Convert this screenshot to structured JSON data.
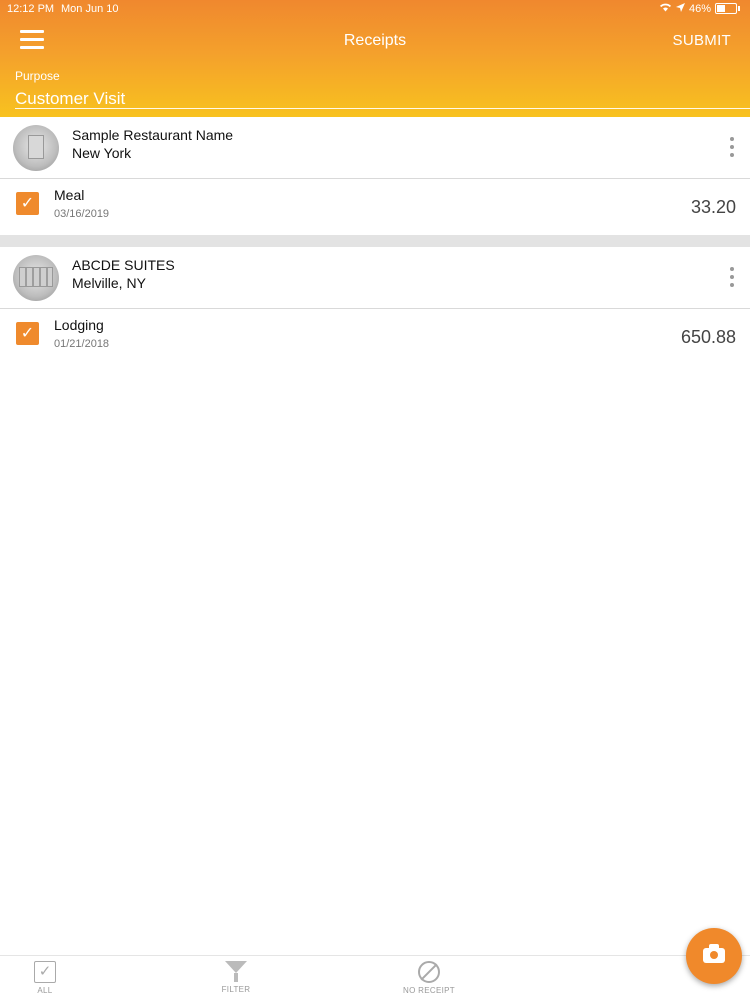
{
  "status_bar": {
    "time": "12:12 PM",
    "date": "Mon Jun 10",
    "battery": "46%"
  },
  "header": {
    "title": "Receipts",
    "submit_label": "SUBMIT"
  },
  "purpose": {
    "label": "Purpose",
    "value": "Customer Visit"
  },
  "receipts": [
    {
      "merchant": "Sample Restaurant Name",
      "location": "New York",
      "category": "Meal",
      "date": "03/16/2019",
      "amount": "33.20",
      "checked": true
    },
    {
      "merchant": "ABCDE SUITES",
      "location": "Melville, NY",
      "category": "Lodging",
      "date": "01/21/2018",
      "amount": "650.88",
      "checked": true
    }
  ],
  "bottom_tabs": {
    "all": "ALL",
    "filter": "FILTER",
    "no_receipt": "NO RECEIPT"
  },
  "icons": {
    "check": "✓"
  },
  "colors": {
    "accent": "#ef8a2d",
    "header_top": "#f0882e",
    "header_bottom": "#f8c21f"
  }
}
